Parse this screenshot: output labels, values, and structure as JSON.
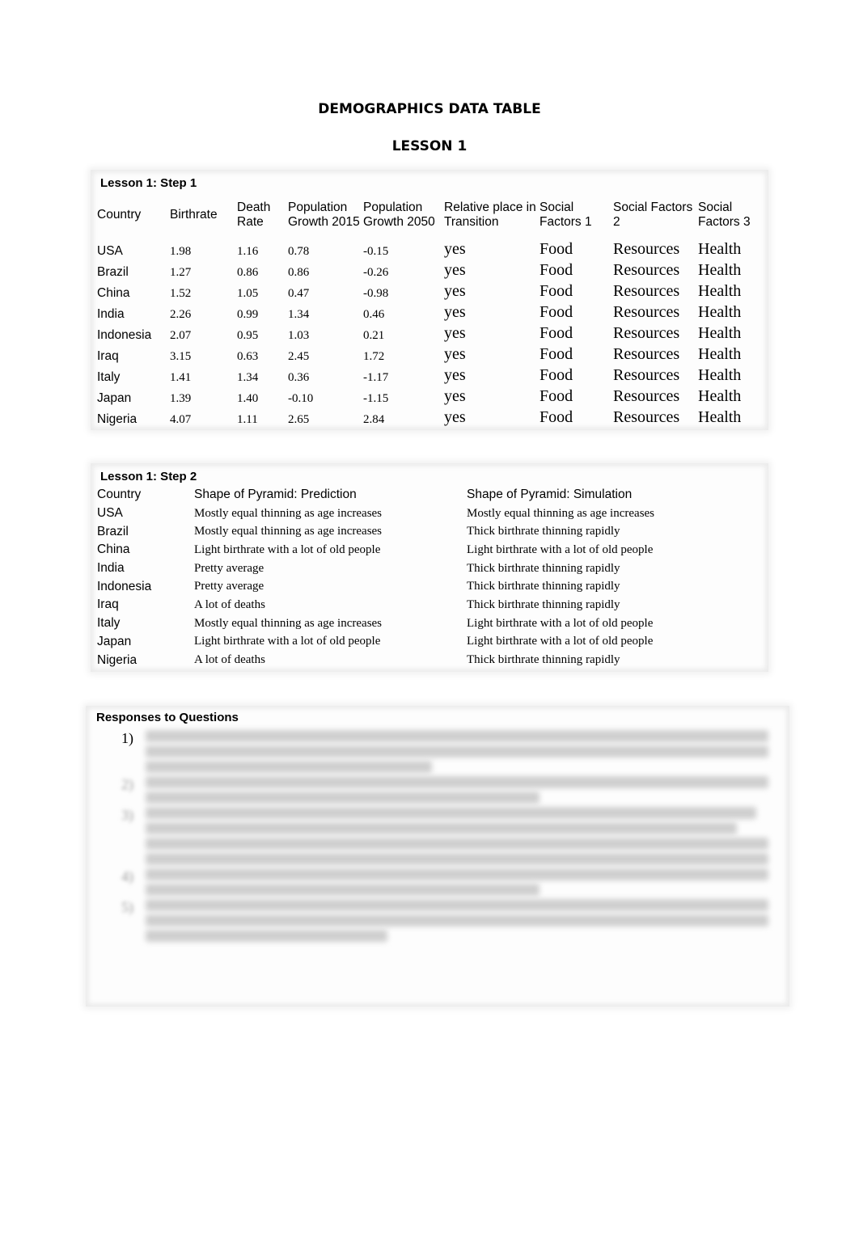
{
  "document": {
    "title": "DEMOGRAPHICS DATA TABLE",
    "subtitle": "LESSON 1"
  },
  "step1": {
    "title": "Lesson 1:  Step 1",
    "headers": [
      "Country",
      "Birthrate",
      "Death Rate",
      "Population Growth 2015",
      "Population Growth 2050",
      "Relative place in Transition",
      "Social Factors 1",
      "Social Factors 2",
      "Social Factors 3"
    ],
    "rows": [
      {
        "country": "USA",
        "birthrate": "1.98",
        "death_rate": "1.16",
        "growth_2015": "0.78",
        "growth_2050": "-0.15",
        "transition": "yes",
        "factor1": "Food",
        "factor2": "Resources",
        "factor3": "Health"
      },
      {
        "country": "Brazil",
        "birthrate": "1.27",
        "death_rate": "0.86",
        "growth_2015": "0.86",
        "growth_2050": "-0.26",
        "transition": "yes",
        "factor1": "Food",
        "factor2": "Resources",
        "factor3": "Health"
      },
      {
        "country": "China",
        "birthrate": "1.52",
        "death_rate": "1.05",
        "growth_2015": "0.47",
        "growth_2050": "-0.98",
        "transition": "yes",
        "factor1": "Food",
        "factor2": "Resources",
        "factor3": "Health"
      },
      {
        "country": "India",
        "birthrate": "2.26",
        "death_rate": "0.99",
        "growth_2015": "1.34",
        "growth_2050": "0.46",
        "transition": "yes",
        "factor1": "Food",
        "factor2": "Resources",
        "factor3": "Health"
      },
      {
        "country": "Indonesia",
        "birthrate": "2.07",
        "death_rate": "0.95",
        "growth_2015": "1.03",
        "growth_2050": "0.21",
        "transition": "yes",
        "factor1": "Food",
        "factor2": "Resources",
        "factor3": "Health"
      },
      {
        "country": "Iraq",
        "birthrate": "3.15",
        "death_rate": "0.63",
        "growth_2015": "2.45",
        "growth_2050": "1.72",
        "transition": "yes",
        "factor1": "Food",
        "factor2": "Resources",
        "factor3": "Health"
      },
      {
        "country": "Italy",
        "birthrate": "1.41",
        "death_rate": "1.34",
        "growth_2015": "0.36",
        "growth_2050": "-1.17",
        "transition": "yes",
        "factor1": "Food",
        "factor2": "Resources",
        "factor3": "Health"
      },
      {
        "country": "Japan",
        "birthrate": "1.39",
        "death_rate": "1.40",
        "growth_2015": "-0.10",
        "growth_2050": "-1.15",
        "transition": "yes",
        "factor1": "Food",
        "factor2": "Resources",
        "factor3": "Health"
      },
      {
        "country": "Nigeria",
        "birthrate": "4.07",
        "death_rate": "1.11",
        "growth_2015": "2.65",
        "growth_2050": "2.84",
        "transition": "yes",
        "factor1": "Food",
        "factor2": "Resources",
        "factor3": "Health"
      }
    ]
  },
  "step2": {
    "title": "Lesson 1:  Step 2",
    "headers": [
      "Country",
      "Shape of Pyramid: Prediction",
      "Shape of Pyramid: Simulation"
    ],
    "rows": [
      {
        "country": "USA",
        "prediction": "Mostly equal thinning as age increases",
        "simulation": "Mostly equal thinning as age increases"
      },
      {
        "country": "Brazil",
        "prediction": "Mostly equal thinning as age increases",
        "simulation": "Thick birthrate thinning rapidly"
      },
      {
        "country": "China",
        "prediction": "Light birthrate with a lot of old people",
        "simulation": "Light birthrate with a lot of old people"
      },
      {
        "country": "India",
        "prediction": "Pretty average",
        "simulation": "Thick birthrate thinning rapidly"
      },
      {
        "country": "Indonesia",
        "prediction": "Pretty average",
        "simulation": "Thick birthrate thinning rapidly"
      },
      {
        "country": "Iraq",
        "prediction": "A lot of deaths",
        "simulation": "Thick birthrate thinning rapidly"
      },
      {
        "country": "Italy",
        "prediction": "Mostly equal thinning as age increases",
        "simulation": "Light birthrate with a lot of old people"
      },
      {
        "country": "Japan",
        "prediction": "Light birthrate with a lot of old people",
        "simulation": "Light birthrate with a lot of old people"
      },
      {
        "country": "Nigeria",
        "prediction": "A lot of deaths",
        "simulation": "Thick birthrate thinning rapidly"
      }
    ]
  },
  "responses": {
    "title": "Responses to Questions",
    "items": [
      {
        "number": "1)",
        "blurred": true,
        "line_count": 3
      },
      {
        "number": "2)",
        "blurred": true,
        "line_count": 2
      },
      {
        "number": "3)",
        "blurred": true,
        "line_count": 4
      },
      {
        "number": "4)",
        "blurred": true,
        "line_count": 2
      },
      {
        "number": "5)",
        "blurred": true,
        "line_count": 3
      }
    ]
  }
}
